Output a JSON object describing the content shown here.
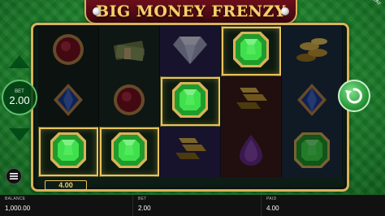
{
  "title": "BIG MONEY FRENZY",
  "demo_label": "DEMO PLAY",
  "bet_control": {
    "label": "BET",
    "value": "2.00"
  },
  "win_amount": "4.00",
  "reels": [
    [
      "ruby",
      "sapphire",
      "emerald"
    ],
    [
      "cash",
      "ruby",
      "emerald"
    ],
    [
      "diamond",
      "emerald",
      "gold-bars"
    ],
    [
      "emerald",
      "gold-bars",
      "amethyst"
    ],
    [
      "gold-coins",
      "sapphire",
      "emerald"
    ]
  ],
  "winning_positions": [
    [
      0,
      2
    ],
    [
      1,
      2
    ],
    [
      2,
      1
    ],
    [
      3,
      0
    ]
  ],
  "status_bar": {
    "balance_label": "BALANCE",
    "balance_value": "1,000.00",
    "bet_label": "BET",
    "bet_value": "2.00",
    "paid_label": "PAID",
    "paid_value": "4.00"
  },
  "colors": {
    "gold_frame": "#d9b25a",
    "background": "#1f7a2c",
    "emerald": "#2ecc40"
  }
}
